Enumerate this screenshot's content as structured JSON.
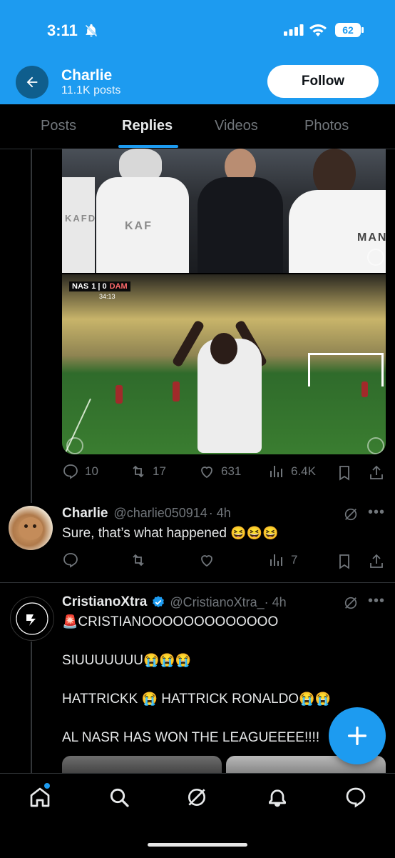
{
  "status_bar": {
    "time": "3:11",
    "battery": "62"
  },
  "header": {
    "name": "Charlie",
    "posts_count": "11.1K posts",
    "follow_label": "Follow"
  },
  "tabs": [
    {
      "label": "Posts"
    },
    {
      "label": "Replies",
      "active": true
    },
    {
      "label": "Videos"
    },
    {
      "label": "Photos"
    }
  ],
  "media": {
    "scorebug": {
      "home": "NAS",
      "score": "1 | 0",
      "away": "DAM",
      "clock": "34:13"
    },
    "jersey_text_left": "KAFD",
    "jersey_text_mid": "KAF",
    "jersey_text_right": "MAN"
  },
  "post1_actions": {
    "replies": "10",
    "reposts": "17",
    "likes": "631",
    "views": "6.4K"
  },
  "post2": {
    "name": "Charlie",
    "handle": "@charlie050914",
    "time": "· 4h",
    "text": "Sure, that’s what happened",
    "emojis": "😆😆😆",
    "actions": {
      "replies": "",
      "reposts": "",
      "likes": "",
      "views": "7"
    }
  },
  "post3": {
    "name": "CristianoXtra",
    "handle": "@CristianoXtra_",
    "time": "· 4h",
    "line1_emoji": "🚨",
    "line1": "CRISTIANOOOOOOOOOOOOO",
    "line2": "SIUUUUUUU",
    "line2_emoji": "😭😭😭",
    "line3a": "HATTRICKK",
    "line3_emoji_a": "😭",
    "line3b": "HATTRICK RONALDO",
    "line3_emoji_b": "😭😭",
    "line4": "AL NASR HAS WON THE LEAGUEEEE!!!!"
  },
  "colors": {
    "accent": "#1d9bf0",
    "background": "#000000",
    "muted": "#71767b"
  }
}
